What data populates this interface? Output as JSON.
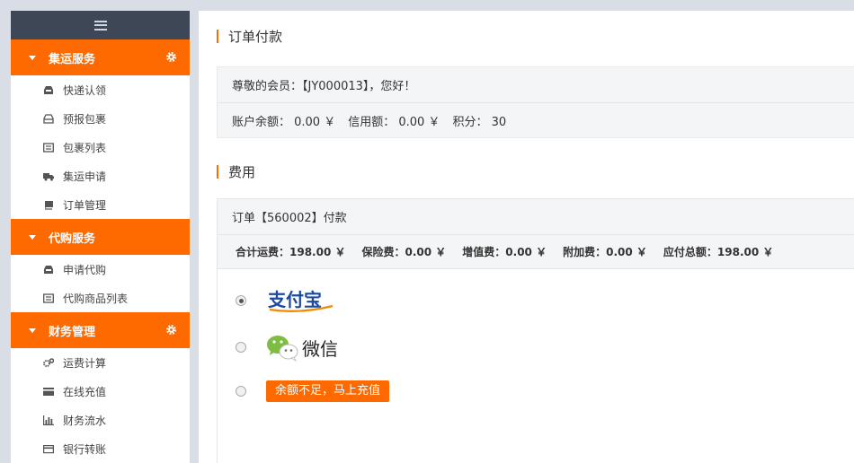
{
  "sidebar": {
    "sections": [
      {
        "title": "集运服务",
        "items": [
          {
            "label": "快递认领",
            "icon": "inbox-icon"
          },
          {
            "label": "预报包裹",
            "icon": "tray-icon"
          },
          {
            "label": "包裹列表",
            "icon": "list-icon"
          },
          {
            "label": "集运申请",
            "icon": "truck-icon"
          },
          {
            "label": "订单管理",
            "icon": "book-icon"
          }
        ]
      },
      {
        "title": "代购服务",
        "items": [
          {
            "label": "申请代购",
            "icon": "inbox-icon"
          },
          {
            "label": "代购商品列表",
            "icon": "list-icon"
          }
        ]
      },
      {
        "title": "财务管理",
        "items": [
          {
            "label": "运费计算",
            "icon": "cogs-icon"
          },
          {
            "label": "在线充值",
            "icon": "card-icon"
          },
          {
            "label": "财务流水",
            "icon": "bar-chart-icon"
          },
          {
            "label": "银行转账",
            "icon": "bank-card-icon"
          }
        ]
      }
    ]
  },
  "main": {
    "payment_title": "订单付款",
    "greeting": "尊敬的会员：【JY000013】，您好！",
    "account": {
      "balance": "账户余额： 0.00 ￥",
      "credit": "信用额： 0.00 ￥",
      "points": "积分： 30"
    },
    "fee_title": "费用",
    "order_line": "订单【560002】付款",
    "summary": {
      "freight": "合计运费：198.00 ￥",
      "insurance": "保险费：0.00 ￥",
      "value_added": "增值费：0.00 ￥",
      "surcharge": "附加费：0.00 ￥",
      "total": "应付总额：198.00 ￥"
    },
    "payment_methods": {
      "alipay_logo_text": "支付宝",
      "wechat_label": "微信",
      "recharge_label": "余额不足，马上充值"
    }
  },
  "colors": {
    "accent": "#ff6a00",
    "sidebar_top": "#3d4756",
    "background": "#d8dde6"
  }
}
